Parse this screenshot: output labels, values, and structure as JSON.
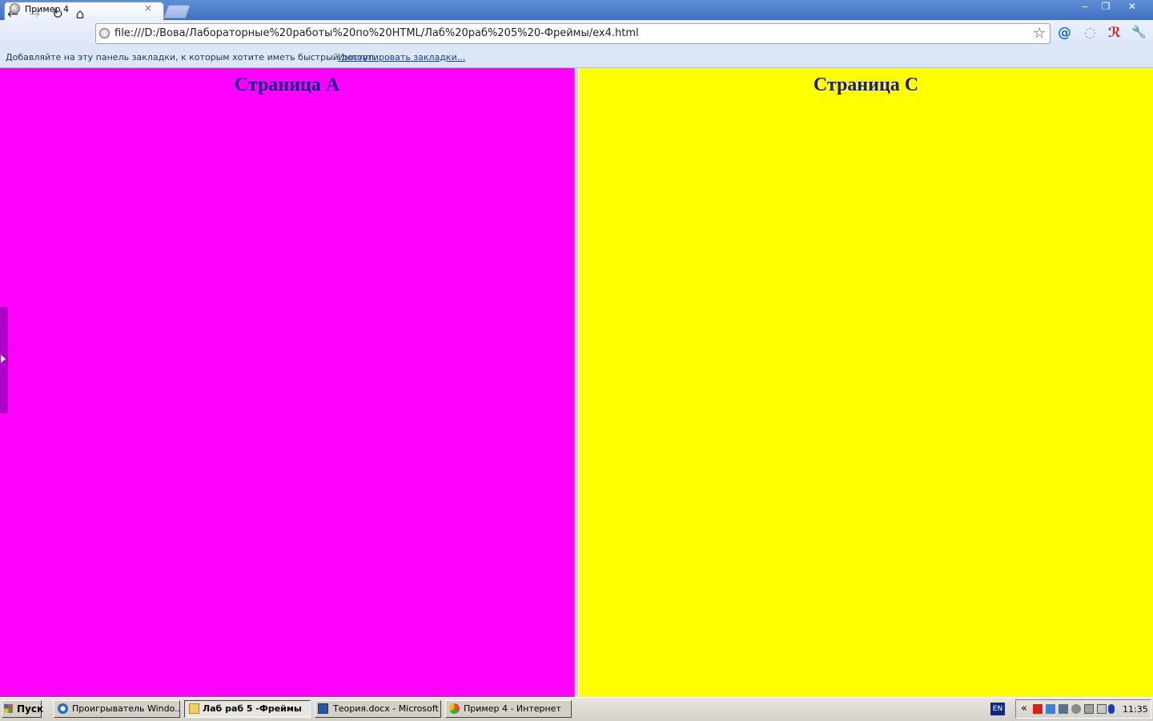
{
  "browser": {
    "tab_title": "Пример 4",
    "tab_close": "×",
    "url": "file:///D:/Вова/Лабораторные%20работы%20по%20HTML/Лаб%20раб%205%20-Фреймы/ex4.html",
    "window_controls": {
      "minimize": "‒",
      "restore": "❐",
      "close": "✕"
    }
  },
  "toolbar": {
    "back_icon": "←",
    "forward_icon": "→",
    "reload_icon": "↻",
    "home_icon": "⌂",
    "star_icon": "☆",
    "mail_icon": "@",
    "search_ext_icon": "◌",
    "antivirus_icon": "ℛ",
    "wrench_icon": "🔧"
  },
  "bookmarks_bar": {
    "message": "Добавляйте на эту панель закладки, к которым хотите иметь быстрый доступ.",
    "import_link": "Импортировать закладки..."
  },
  "frames": {
    "left": {
      "heading": "Страница A",
      "background": "#ff00ff"
    },
    "right": {
      "heading": "Страница C",
      "background": "#ffff00"
    }
  },
  "taskbar": {
    "start_label": "Пуск",
    "tasks": [
      {
        "label": "Проигрыватель Windo...",
        "active": false
      },
      {
        "label": "Лаб раб 5 -Фреймы",
        "active": true
      },
      {
        "label": "Теория.docx - Microsoft ...",
        "active": false
      },
      {
        "label": "Пример 4 - Интернет",
        "active": false
      }
    ],
    "language": "EN",
    "tray_expand": "«",
    "clock": "11:35"
  },
  "colors": {
    "heading_text": "#1c1a8a",
    "frame_divider": "#d4d0c8",
    "side_handle": "#b000c8"
  }
}
